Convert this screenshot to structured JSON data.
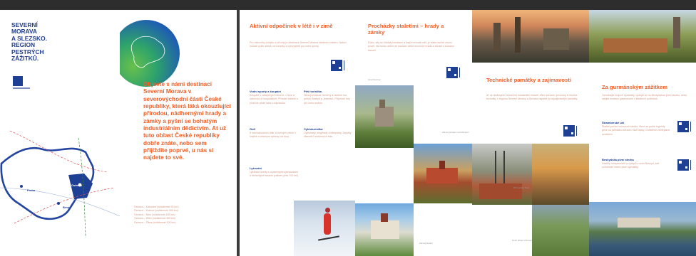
{
  "cover": {
    "brand_lines": [
      "SEVERNÍ",
      "MORAVA",
      "A SLEZSKO.",
      "REGION",
      "PESTRÝCH",
      "ZÁŽITKŮ."
    ],
    "intro": "Objevte s námi destinaci Severní Morava v severovýchodní části České republiky, která láká okouzlující přírodou, nádhernými hrady a zámky a pyšní se bohatým industriálním dědictvím. At už tuto oblast České republiky dobře znáte, nebo sem přijíždíte poprvé, u nás si najdete to své.",
    "map_cities": [
      "Praha",
      "Brno",
      "Ostrava"
    ],
    "distances": [
      {
        "route": "Ostrava – Katowice",
        "value": "(vzdálenost 90 km)"
      },
      {
        "route": "Ostrava – Kraków",
        "value": "(vzdálenost 165 km)"
      },
      {
        "route": "Ostrava – Brno",
        "value": "(vzdálenost 165 km)"
      },
      {
        "route": "Ostrava – Wien",
        "value": "(vzdálenost 300 km)"
      },
      {
        "route": "Ostrava – Žilina",
        "value": "(vzdálenost 100 km)"
      }
    ]
  },
  "active": {
    "title": "Aktivní odpočinek v létě i v zimě",
    "body": "Pro milovníky pohybu a přírody je destinace Severní Morava ideálním místem. Nabízí bohaté vyžití aktivit, od turistiky a cyklovýletů po vodní sporty.",
    "blocks": [
      {
        "title": "Vodní sporty a koupání",
        "text": "Koupání v zatopených lomech, v řece a rybnících či koupalištích. Přírodní nádrže a písečné pláže láká k odpočinku."
      },
      {
        "title": "Pěší turistika",
        "text": "Stezky vedoucí hřebeny a údolími hor, pohoří Beskyd a Jeseníků. Příjemné túry pro celou rodinu."
      },
      {
        "title": "Golf",
        "text": "8 mezinárodních hřišť a cvičných ploch v krajině s krásnými výhledy na hory."
      },
      {
        "title": "Cykloturistika",
        "text": "Cyklotrasy, singltraily a bikeparky. Desítky kilometrů značených tras."
      },
      {
        "title": "Lyžování",
        "text": "Lyžařské areály s upravenými sjezdovkami a běžeckými trasami (celkem přes 700 km)."
      }
    ]
  },
  "castles": {
    "title": "Procházky staletími – hrady a zámky",
    "body": "Dobu, kdy se hledaly bohatství a kraji formoval svět, je stále možné znovu prožít. Na tomto území se nachází velké množství hradů a zámků s bohatou historií.",
    "captions": [
      "Hrad Sovinec",
      "Zámek Hradec nad Moravicí",
      "Zámek Raduň",
      "Zámek Kravaře"
    ]
  },
  "tech": {
    "title": "Technické památky a zajímavosti",
    "body": "Ať už obdivujete železniční industriální historii, důlní zařízení, pivovary či muzea techniky, v regionu Severní Moravy a Slezska najdete ty nejzajímavější památky.",
    "captions": [
      "Dolní oblast Vítkovice",
      "Důl Landek Park"
    ]
  },
  "gourmet": {
    "title": "Za gurmánským zážitkem",
    "body": "Ochutnejte krajové speciality, vydejte se na Beskydskou pivní stezku, nebo zažijte moderní gastronomii v lokálních podnicích.",
    "blocks": [
      {
        "title": "Štramberské uši",
        "text": "Sladké pečivo ochucené skořicí, které se podle legendy peče na památku vítězství nad Tatary. Chráněné zeměpisné označení."
      },
      {
        "title": "Beskydská pivní stezka",
        "text": "Desítky minipivovarů a výčepů v srdci Beskyd, kde ochutnáte místní pivní speciality."
      }
    ]
  }
}
